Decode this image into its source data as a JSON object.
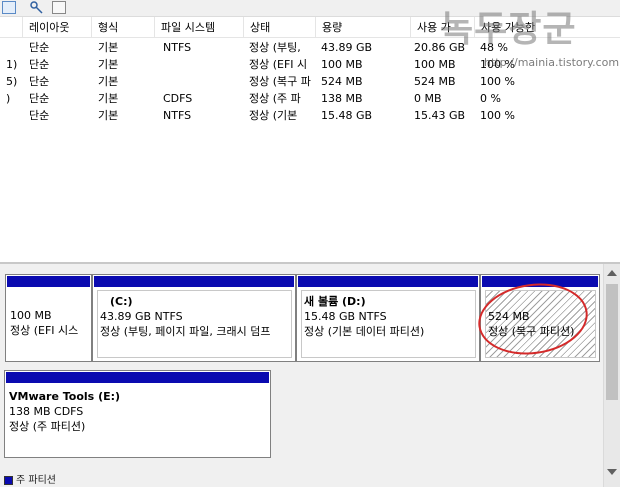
{
  "columns": [
    "",
    "레이아웃",
    "형식",
    "파일 시스템",
    "상태",
    "용량",
    "사용 가",
    "사용 가능한"
  ],
  "rows": [
    {
      "vol": "",
      "layout": "단순",
      "type": "기본",
      "fs": "NTFS",
      "status": "정상 (부팅,",
      "capacity": "43.89 GB",
      "free": "20.86 GB",
      "pct": "48 %"
    },
    {
      "vol": "1)",
      "layout": "단순",
      "type": "기본",
      "fs": "",
      "status": "정상 (EFI 시",
      "capacity": "100 MB",
      "free": "100 MB",
      "pct": "100 %"
    },
    {
      "vol": "5)",
      "layout": "단순",
      "type": "기본",
      "fs": "",
      "status": "정상 (복구 파",
      "capacity": "524 MB",
      "free": "524 MB",
      "pct": "100 %"
    },
    {
      "vol": ")",
      "layout": "단순",
      "type": "기본",
      "fs": "CDFS",
      "status": "정상 (주 파",
      "capacity": "138 MB",
      "free": "0 MB",
      "pct": "0 %"
    },
    {
      "vol": "",
      "layout": "단순",
      "type": "기본",
      "fs": "NTFS",
      "status": "정상 (기본 ",
      "capacity": "15.48 GB",
      "free": "15.43 GB",
      "pct": "100 %"
    }
  ],
  "volumes": {
    "efi": {
      "line1": "100 MB",
      "line2": "정상 (EFI 시스"
    },
    "c": {
      "name": "(C:)",
      "line1": "43.89 GB NTFS",
      "line2": "정상 (부팅, 페이지 파일, 크래시 덤프"
    },
    "d": {
      "name": "새 볼륨  (D:)",
      "line1": "15.48 GB NTFS",
      "line2": "정상 (기본 데이터 파티션)"
    },
    "recovery": {
      "line1": "524 MB",
      "line2": "정상 (복구 파티션)"
    },
    "e": {
      "name": "VMware Tools  (E:)",
      "line1": "138 MB CDFS",
      "line2": "정상 (주 파티션)"
    }
  },
  "status_bar": "주 파티션",
  "watermark": {
    "title": "녹두장군",
    "url": "http://mainia.tistory.com"
  },
  "colors": {
    "volume_bar": "#0a0ab0",
    "highlight_circle": "#d42a2a"
  }
}
